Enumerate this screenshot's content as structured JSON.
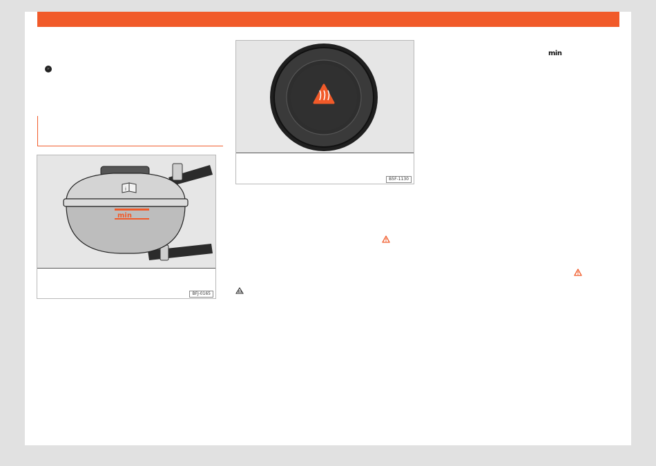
{
  "page": {
    "accent_color": "#f15a29",
    "note_icon": "note-icon"
  },
  "figure_reservoir": {
    "code": "BFJ-0165",
    "marking": "min",
    "icons": [
      "book-icon",
      "min-level-icon"
    ]
  },
  "figure_cap": {
    "code": "B5F-1130",
    "icons": [
      "hot-coolant-warning-icon"
    ]
  },
  "inline": {
    "min_label": "min",
    "icons": [
      "warning-triangle-icon",
      "hot-coolant-icon"
    ]
  }
}
